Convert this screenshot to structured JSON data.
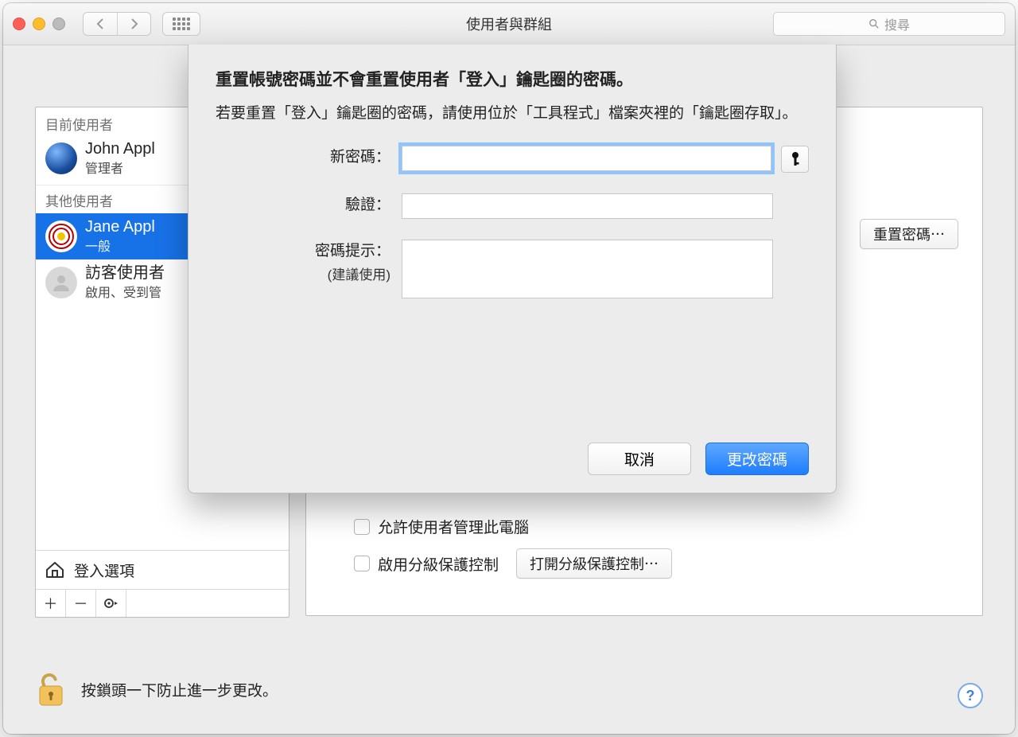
{
  "window": {
    "title": "使用者與群組",
    "search_placeholder": "搜尋"
  },
  "sidebar": {
    "current_label": "目前使用者",
    "current_user": {
      "name": "John Appl",
      "role": "管理者"
    },
    "other_label": "其他使用者",
    "items": [
      {
        "name": "Jane Appl",
        "role": "一般"
      },
      {
        "name": "訪客使用者",
        "role": "啟用、受到管"
      }
    ],
    "login_options": "登入選項"
  },
  "detail": {
    "reset_password_btn": "重置密碼⋯",
    "allow_admin": "允許使用者管理此電腦",
    "enable_parental": "啟用分級保護控制",
    "open_parental_btn": "打開分級保護控制⋯"
  },
  "lock": {
    "text": "按鎖頭一下防止進一步更改。"
  },
  "sheet": {
    "heading": "重置帳號密碼並不會重置使用者「登入」鑰匙圈的密碼。",
    "body": "若要重置「登入」鑰匙圈的密碼，請使用位於「工具程式」檔案夾裡的「鑰匙圈存取」。",
    "labels": {
      "new_password": "新密碼：",
      "verify": "驗證：",
      "hint": "密碼提示：",
      "hint_sub": "(建議使用)"
    },
    "buttons": {
      "cancel": "取消",
      "change": "更改密碼"
    }
  }
}
